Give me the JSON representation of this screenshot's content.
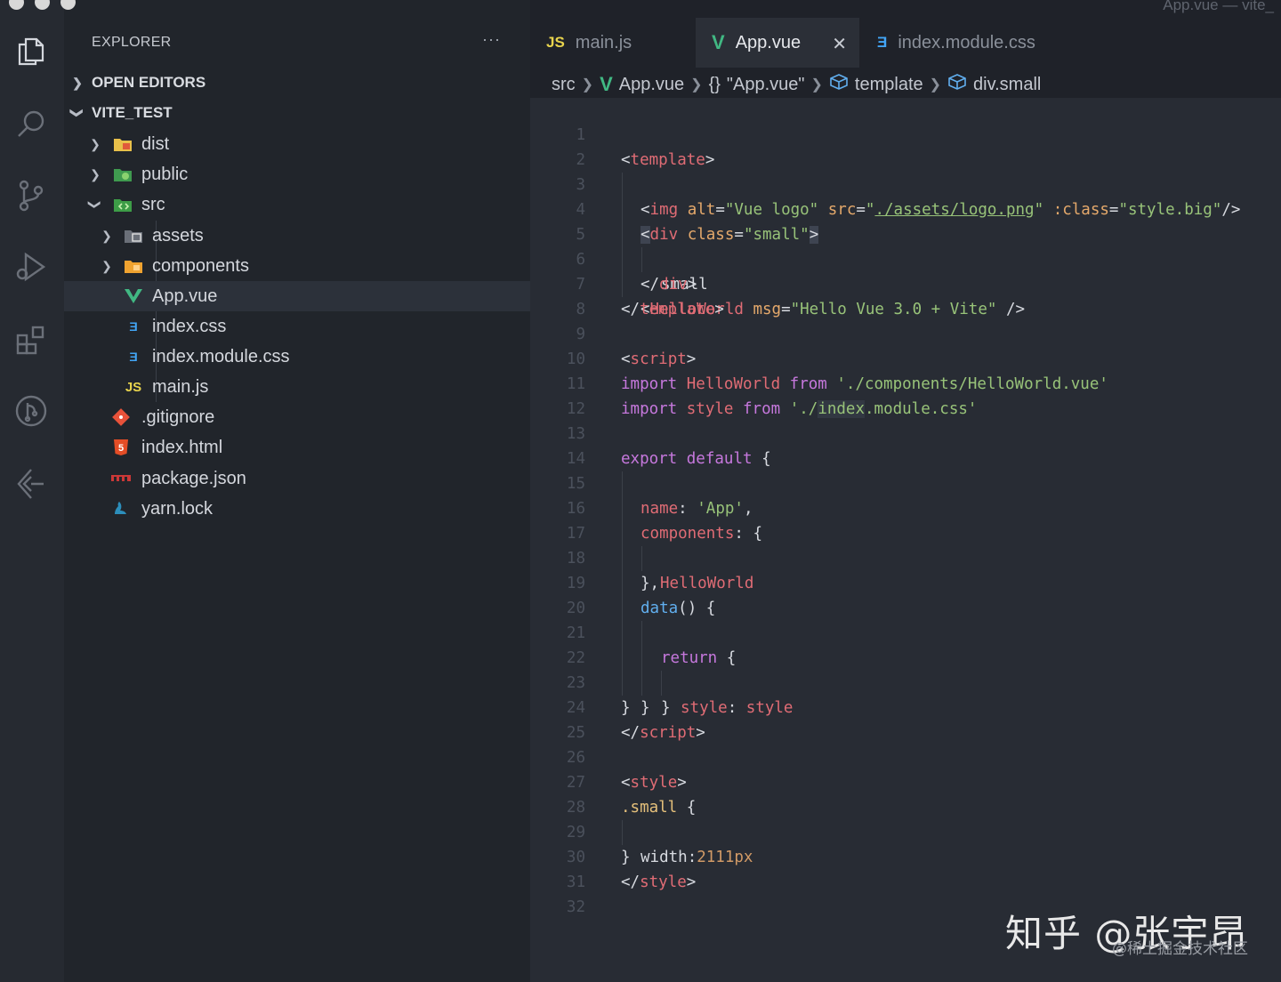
{
  "window": {
    "title": "App.vue — vite_"
  },
  "activity_bar": {
    "icons": [
      "explorer-icon",
      "search-icon",
      "source-control-icon",
      "run-debug-icon",
      "extensions-icon",
      "git-graph-icon",
      "remote-explorer-icon"
    ]
  },
  "sidebar": {
    "title": "EXPLORER",
    "more": "···",
    "open_editors": "OPEN EDITORS",
    "project": "VITE_TEST",
    "items": [
      {
        "label": "dist",
        "icon": "folder-dist-icon"
      },
      {
        "label": "public",
        "icon": "folder-public-icon"
      },
      {
        "label": "src",
        "icon": "folder-src-icon"
      },
      {
        "label": "assets",
        "icon": "folder-assets-icon"
      },
      {
        "label": "components",
        "icon": "folder-components-icon"
      },
      {
        "label": "App.vue",
        "icon": "vue-file-icon"
      },
      {
        "label": "index.css",
        "icon": "css-file-icon"
      },
      {
        "label": "index.module.css",
        "icon": "css-file-icon"
      },
      {
        "label": "main.js",
        "icon": "js-file-icon"
      },
      {
        "label": ".gitignore",
        "icon": "git-file-icon"
      },
      {
        "label": "index.html",
        "icon": "html-file-icon"
      },
      {
        "label": "package.json",
        "icon": "npm-file-icon"
      },
      {
        "label": "yarn.lock",
        "icon": "yarn-file-icon"
      }
    ]
  },
  "tabs": [
    {
      "icon_text": "JS",
      "label": "main.js"
    },
    {
      "icon_text": "V",
      "label": "App.vue",
      "active": true,
      "close": "✕"
    },
    {
      "icon_text": "3",
      "label": "index.module.css"
    }
  ],
  "breadcrumb": {
    "src": "src",
    "file": "App.vue",
    "braces": "{}",
    "component": "\"App.vue\"",
    "template": "template",
    "element": "div.small"
  },
  "editor": {
    "line_numbers": [
      "1",
      "2",
      "3",
      "4",
      "5",
      "6",
      "7",
      "8",
      "9",
      "10",
      "11",
      "12",
      "13",
      "14",
      "15",
      "16",
      "17",
      "18",
      "19",
      "20",
      "21",
      "22",
      "23",
      "24",
      "25",
      "26",
      "27",
      "28",
      "29",
      "30",
      "31",
      "32"
    ],
    "tokens": {
      "lt": "<",
      "gt": ">",
      "ltslash": "</",
      "selfclose": " />",
      "slashgt": "/>",
      "eq": "=",
      "template": "template",
      "img": "img",
      "div": "div",
      "script": "script",
      "style": "style",
      "helloworld_tag": "HelloWorld",
      "alt": "alt",
      "alt_val": "\"Vue logo\"",
      "src": "src",
      "q": "\"",
      "src_val": "./assets/logo.png",
      "bind_class": ":class",
      "bind_val": "\"style.big\"",
      "class": "class",
      "small_val": "\"small\"",
      "small_text": "small",
      "msg": "msg",
      "msg_val": "\"Hello Vue 3.0 + Vite\"",
      "import": "import",
      "from": "from",
      "helloworld": "HelloWorld",
      "style_id": "style",
      "path1": "'./components/HelloWorld.vue'",
      "path2a": "'./",
      "path2b": "index",
      "path2c": ".module.css'",
      "export": "export",
      "default": "default",
      "lbrace": "{",
      "rbrace": "}",
      "rbrace_comma": "},",
      "name": "name",
      "colon": ":",
      "app_str": "'App'",
      "comma": ",",
      "components": "components",
      "data": "data",
      "parens": "()",
      "return": "return",
      "style_prop": "style",
      "small_sel": ".small",
      "width": "width",
      "width_val": "2111px"
    }
  },
  "watermark": {
    "main": "知乎 @张宇昂",
    "sub": "@稀土掘金技术社区"
  }
}
